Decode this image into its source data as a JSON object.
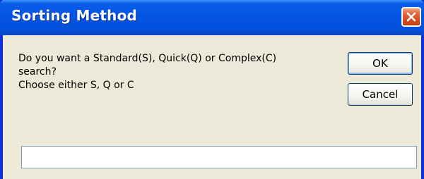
{
  "window": {
    "title": "Sorting Method"
  },
  "titlebar": {
    "close_icon": "close-icon"
  },
  "message": {
    "line1": "Do you want a Standard(S), Quick(Q) or Complex(C)",
    "line2": "search?",
    "line3": "Choose either S, Q or C"
  },
  "buttons": {
    "ok_label": "OK",
    "cancel_label": "Cancel"
  },
  "input": {
    "value": "",
    "placeholder": ""
  },
  "colors": {
    "titlebar": "#0454e3",
    "frame": "#0831d9",
    "dialog_background": "#ece9d8",
    "close_button": "#d44a22"
  }
}
